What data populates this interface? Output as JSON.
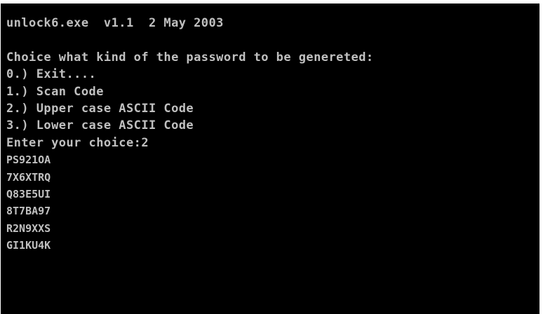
{
  "console": {
    "background_color": "#000000",
    "text_color": "#c0c0c0",
    "header": "unlock6.exe  v1.1  2 May 2003",
    "blank": "",
    "prompt_title": "Choice what kind of the password to be genereted:",
    "options": [
      "0.) Exit....",
      "1.) Scan Code",
      "2.) Upper case ASCII Code",
      "3.) Lower case ASCII Code"
    ],
    "input_prompt": "Enter your choice:2",
    "passwords": [
      "PS921OA",
      "7X6XTRQ",
      "Q83E5UI",
      "8T7BA97",
      "R2N9XXS",
      "GI1KU4K"
    ]
  }
}
